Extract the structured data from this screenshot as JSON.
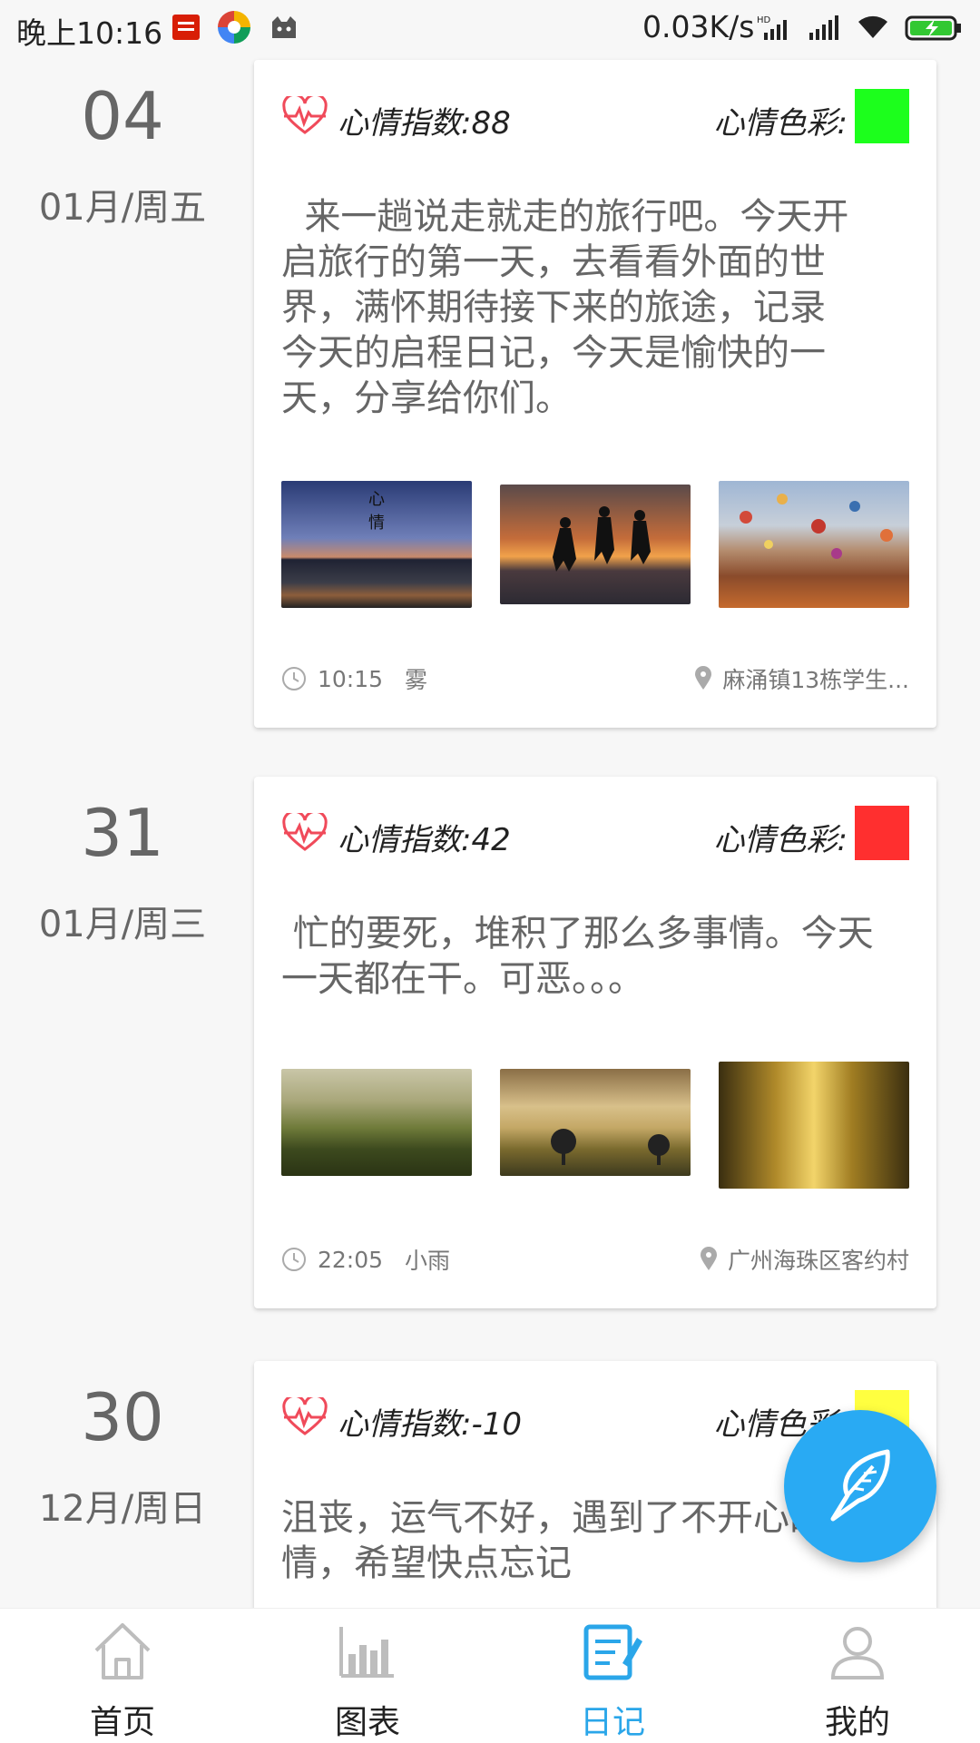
{
  "status_bar": {
    "time": "晚上10:16",
    "network_speed": "0.03K/s",
    "icons": [
      "netease-app-icon",
      "colorful-app-icon",
      "cat-app-icon",
      "hd-signal-icon",
      "signal-icon",
      "wifi-icon",
      "battery-charging-icon"
    ]
  },
  "entries": [
    {
      "day": "04",
      "month_week": "01月/周五",
      "mood_index_label": "心情指数:88",
      "mood_color_label": "心情色彩:",
      "mood_color": "#1cff1c",
      "text": "  来一趟说走就走的旅行吧。今天开\n启旅行的第一天，去看看外面的世\n界，满怀期待接下来的旅途，记录\n今天的启程日记，今天是愉快的一\n天，分享给你们。",
      "photos": [
        "night-bridge-photo",
        "sunset-jump-photo",
        "hot-air-balloons-photo"
      ],
      "photo_overlay_text": "心\n情",
      "time": "10:15",
      "weather": "雾",
      "location": "麻涌镇13栋学生..."
    },
    {
      "day": "31",
      "month_week": "01月/周三",
      "mood_index_label": "心情指数:42",
      "mood_color_label": "心情色彩:",
      "mood_color": "#ff2f2f",
      "text": " 忙的要死，堆积了那么多事情。今天\n一天都在干。可恶。。。",
      "photos": [
        "green-hills-photo",
        "misty-field-photo",
        "tree-road-photo"
      ],
      "time": "22:05",
      "weather": "小雨",
      "location": "广州海珠区客约村"
    },
    {
      "day": "30",
      "month_week": "12月/周日",
      "mood_index_label": "心情指数:-10",
      "mood_color_label": "心情色彩:",
      "mood_color": "#ffff40",
      "text": "沮丧，运气不好，遇到了不开心的事\n情，希望快点忘记"
    }
  ],
  "fab": {
    "icon": "feather-pen-icon"
  },
  "nav": {
    "items": [
      {
        "label": "首页",
        "icon": "home-icon"
      },
      {
        "label": "图表",
        "icon": "chart-icon"
      },
      {
        "label": "日记",
        "icon": "diary-icon"
      },
      {
        "label": "我的",
        "icon": "user-icon"
      }
    ],
    "active_index": 2,
    "active_color": "#2aa6e9"
  }
}
